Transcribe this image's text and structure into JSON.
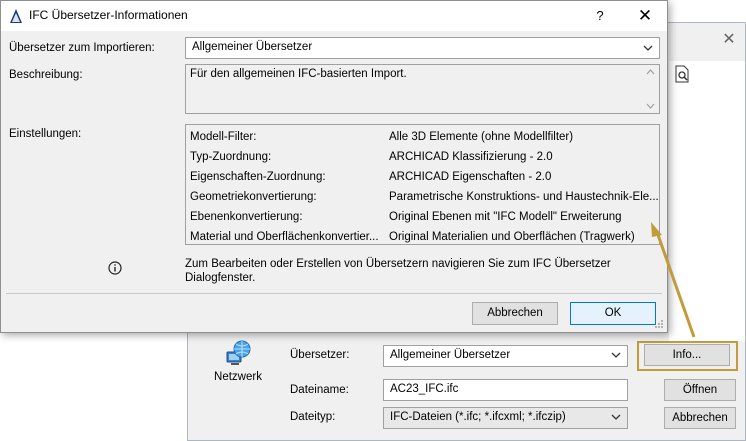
{
  "background_dialog": {
    "network_label": "Netzwerk",
    "translator_label": "Übersetzer:",
    "translator_value": "Allgemeiner Übersetzer",
    "info_button": "Info...",
    "filename_label": "Dateiname:",
    "filename_value": "AC23_IFC.ifc",
    "open_button": "Öffnen",
    "filetype_label": "Dateityp:",
    "filetype_value": "IFC-Dateien (*.ifc; *.ifcxml; *.ifczip)",
    "cancel_button": "Abbrechen",
    "close_glyph": "✕"
  },
  "dialog": {
    "title": "IFC Übersetzer-Informationen",
    "help_glyph": "?",
    "close_glyph": "✕",
    "import_label": "Übersetzer zum Importieren:",
    "import_value": "Allgemeiner Übersetzer",
    "description_label": "Beschreibung:",
    "description_value": "Für den allgemeinen IFC-basierten Import.",
    "settings_label": "Einstellungen:",
    "settings": [
      {
        "key": "Modell-Filter:",
        "value": "Alle 3D Elemente (ohne Modellfilter)"
      },
      {
        "key": "Typ-Zuordnung:",
        "value": "ARCHICAD Klassifizierung - 2.0"
      },
      {
        "key": "Eigenschaften-Zuordnung:",
        "value": "ARCHICAD Eigenschaften - 2.0"
      },
      {
        "key": "Geometriekonvertierung:",
        "value": "Parametrische Konstruktions- und Haustechnik-Ele..."
      },
      {
        "key": "Ebenenkonvertierung:",
        "value": "Original Ebenen mit \"IFC Modell\" Erweiterung"
      },
      {
        "key": "Material und Oberflächenkonvertier...",
        "value": "Original Materialien und Oberflächen (Tragwerk)"
      }
    ],
    "hint": "Zum Bearbeiten oder Erstellen von Übersetzern navigieren Sie zum IFC Übersetzer Dialogfenster.",
    "cancel_button": "Abbrechen",
    "ok_button": "OK"
  },
  "colors": {
    "annotation": "#c19b3c",
    "ok_border": "#0078d7"
  }
}
